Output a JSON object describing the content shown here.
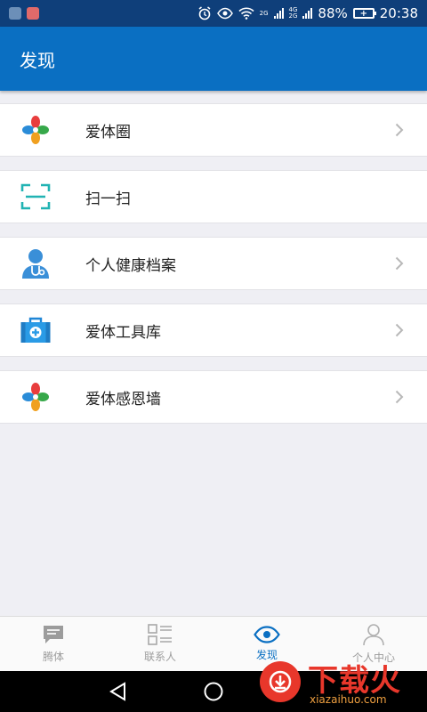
{
  "status_bar": {
    "signal_1": "2G",
    "signal_2a": "4G",
    "signal_2b": "2G",
    "battery_percent": "88%",
    "time": "20:38",
    "icons": [
      "notification-app-icon",
      "notification-mail-icon",
      "alarm-icon",
      "eye-icon",
      "wifi-icon",
      "signal-icon",
      "battery-icon"
    ]
  },
  "header": {
    "title": "发现"
  },
  "menu": {
    "items": [
      {
        "label": "爱体圈",
        "icon": "clover-logo-icon",
        "has_chevron": true
      },
      {
        "label": "扫一扫",
        "icon": "scan-icon",
        "has_chevron": false
      },
      {
        "label": "个人健康档案",
        "icon": "doctor-icon",
        "has_chevron": true
      },
      {
        "label": "爱体工具库",
        "icon": "medical-kit-icon",
        "has_chevron": true
      },
      {
        "label": "爱体感恩墙",
        "icon": "clover-logo-icon",
        "has_chevron": true
      }
    ]
  },
  "tabs": [
    {
      "label": "腾体",
      "icon": "chat-icon",
      "active": false
    },
    {
      "label": "联系人",
      "icon": "contacts-icon",
      "active": false
    },
    {
      "label": "发现",
      "icon": "eye-icon",
      "active": true
    },
    {
      "label": "个人中心",
      "icon": "person-icon",
      "active": false
    }
  ],
  "watermark": {
    "text": "下载火",
    "sub": "xiazaihuo.com"
  },
  "colors": {
    "primary": "#0a6fc2",
    "status_bar": "#0f3f7a",
    "background": "#efeff4",
    "teal": "#21b3b3",
    "watermark": "#e8372b"
  }
}
